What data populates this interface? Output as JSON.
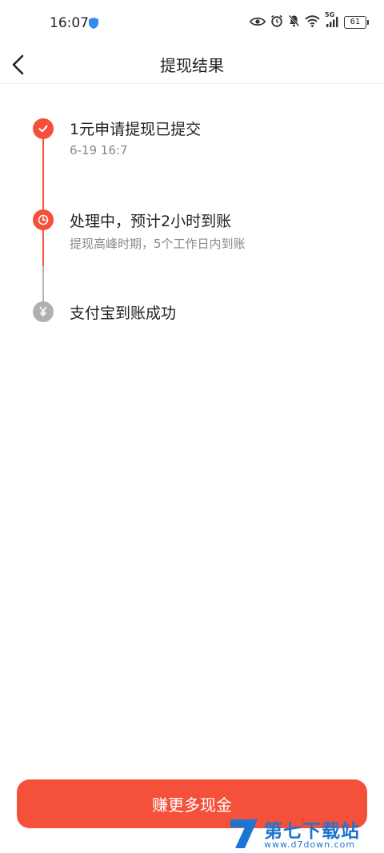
{
  "statusbar": {
    "time": "16:07",
    "battery": "61",
    "network": "5G"
  },
  "header": {
    "title": "提现结果"
  },
  "colors": {
    "accent": "#f5503a",
    "pending": "#b0b0b0",
    "watermark": "#1a76d2"
  },
  "steps": [
    {
      "title": "1元申请提现已提交",
      "subtitle": "6-19 16:7",
      "icon": "check-icon",
      "state": "done"
    },
    {
      "title": "处理中，预计2小时到账",
      "subtitle": "提现高峰时期，5个工作日内到账",
      "icon": "clock-icon",
      "state": "active"
    },
    {
      "title": "支付宝到账成功",
      "subtitle": "",
      "icon": "yuan-icon",
      "state": "pending"
    }
  ],
  "cta": {
    "label": "赚更多现金"
  },
  "watermark": {
    "brand": "第七下载站",
    "url": "www.d7down.com"
  }
}
